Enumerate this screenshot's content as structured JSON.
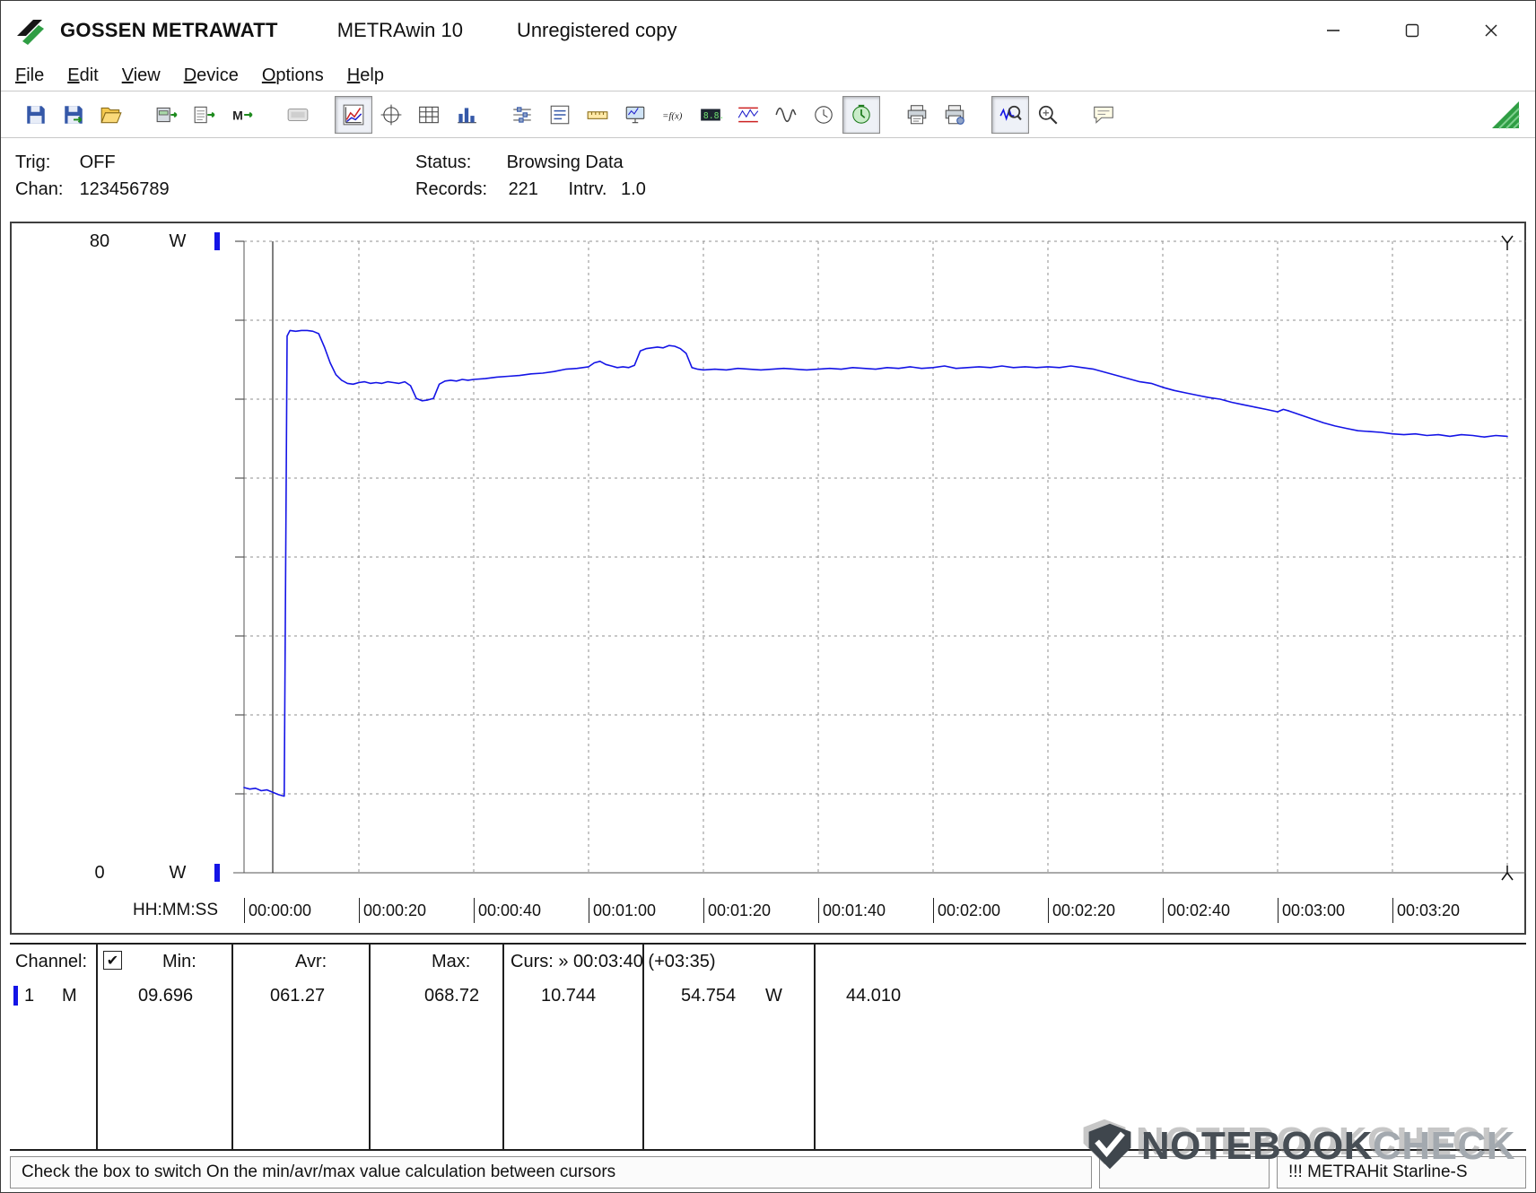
{
  "titlebar": {
    "brand": "GOSSEN METRAWATT",
    "app": "METRAwin 10",
    "license": "Unregistered copy"
  },
  "menu": {
    "items": [
      "File",
      "Edit",
      "View",
      "Device",
      "Options",
      "Help"
    ]
  },
  "toolbar": {
    "buttons": [
      "save-file",
      "save-selection",
      "open-file",
      "device-read",
      "memory-read",
      "memory-store",
      "lcd-display",
      "view-line-chart",
      "view-xy",
      "view-table",
      "view-histogram",
      "transfer-settings",
      "channel-list",
      "scale-settings",
      "monitor-online",
      "formula",
      "numeric-display",
      "limit-lines",
      "analog-wave",
      "interval-clock",
      "record-timer",
      "print",
      "print-form",
      "zoom-signal",
      "zoom-inspect",
      "annotation"
    ],
    "active_buttons": [
      "view-line-chart",
      "record-timer",
      "zoom-signal"
    ]
  },
  "infobar": {
    "trig_label": "Trig:",
    "trig_value": "OFF",
    "chan_label": "Chan:",
    "chan_value": "123456789",
    "status_label": "Status:",
    "status_value": "Browsing Data",
    "records_label": "Records:",
    "records_value": "221",
    "intrv_label": "Intrv.",
    "intrv_value": "1.0"
  },
  "chart_data": {
    "type": "line",
    "title": "",
    "y_axis": {
      "top_label": "80",
      "bottom_label": "0",
      "unit": "W",
      "ylim": [
        0,
        80
      ],
      "tick_step": 10
    },
    "x_axis": {
      "label": "HH:MM:SS",
      "tick_labels": [
        "00:00:00",
        "00:00:20",
        "00:00:40",
        "00:01:00",
        "00:01:20",
        "00:01:40",
        "00:02:00",
        "00:02:20",
        "00:02:40",
        "00:03:00",
        "00:03:20"
      ],
      "tick_step_s": 20,
      "xlim_s": [
        0,
        221
      ],
      "grid": "dashed"
    },
    "cursors": {
      "cursor1_s": 5,
      "cursor2_s": 220,
      "cursor2_label": "00:03:40",
      "delta_label": "+03:35"
    },
    "legend": "off",
    "series": [
      {
        "name": "channel-1-power-W",
        "color": "#1414e6",
        "points": [
          [
            0,
            10.8
          ],
          [
            1,
            10.6
          ],
          [
            2,
            10.7
          ],
          [
            3,
            10.4
          ],
          [
            4,
            10.5
          ],
          [
            5,
            10.2
          ],
          [
            6,
            9.9
          ],
          [
            7,
            9.7
          ],
          [
            7.5,
            68.0
          ],
          [
            8,
            68.7
          ],
          [
            9,
            68.6
          ],
          [
            10,
            68.7
          ],
          [
            11,
            68.7
          ],
          [
            12,
            68.6
          ],
          [
            13,
            68.3
          ],
          [
            14,
            66.6
          ],
          [
            15,
            64.6
          ],
          [
            16,
            63.1
          ],
          [
            17,
            62.4
          ],
          [
            18,
            62.0
          ],
          [
            19,
            61.9
          ],
          [
            20,
            62.1
          ],
          [
            21,
            62.2
          ],
          [
            22,
            62.0
          ],
          [
            23,
            62.1
          ],
          [
            24,
            62.0
          ],
          [
            25,
            62.2
          ],
          [
            26,
            62.1
          ],
          [
            27,
            62.0
          ],
          [
            28,
            62.2
          ],
          [
            29,
            61.7
          ],
          [
            30,
            60.1
          ],
          [
            31,
            59.8
          ],
          [
            32,
            59.9
          ],
          [
            33,
            60.1
          ],
          [
            34,
            61.9
          ],
          [
            35,
            62.3
          ],
          [
            36,
            62.4
          ],
          [
            37,
            62.3
          ],
          [
            38,
            62.5
          ],
          [
            39,
            62.4
          ],
          [
            40,
            62.5
          ],
          [
            42,
            62.6
          ],
          [
            44,
            62.8
          ],
          [
            46,
            62.9
          ],
          [
            48,
            63.0
          ],
          [
            50,
            63.2
          ],
          [
            52,
            63.3
          ],
          [
            54,
            63.5
          ],
          [
            56,
            63.8
          ],
          [
            58,
            63.9
          ],
          [
            60,
            64.1
          ],
          [
            61,
            64.6
          ],
          [
            62,
            64.8
          ],
          [
            63,
            64.4
          ],
          [
            64,
            64.2
          ],
          [
            65,
            64.0
          ],
          [
            66,
            64.1
          ],
          [
            67,
            64.0
          ],
          [
            68,
            64.3
          ],
          [
            69,
            66.1
          ],
          [
            70,
            66.4
          ],
          [
            71,
            66.5
          ],
          [
            72,
            66.6
          ],
          [
            73,
            66.5
          ],
          [
            74,
            66.8
          ],
          [
            75,
            66.7
          ],
          [
            76,
            66.4
          ],
          [
            77,
            65.8
          ],
          [
            78,
            64.0
          ],
          [
            79,
            63.8
          ],
          [
            80,
            63.7
          ],
          [
            82,
            63.8
          ],
          [
            84,
            63.7
          ],
          [
            86,
            63.9
          ],
          [
            88,
            63.8
          ],
          [
            90,
            63.7
          ],
          [
            92,
            63.8
          ],
          [
            94,
            63.9
          ],
          [
            96,
            63.8
          ],
          [
            98,
            63.7
          ],
          [
            100,
            63.8
          ],
          [
            102,
            63.9
          ],
          [
            104,
            63.8
          ],
          [
            106,
            64.0
          ],
          [
            108,
            63.9
          ],
          [
            110,
            63.8
          ],
          [
            112,
            64.0
          ],
          [
            114,
            63.9
          ],
          [
            116,
            64.1
          ],
          [
            118,
            63.9
          ],
          [
            120,
            64.0
          ],
          [
            122,
            64.2
          ],
          [
            124,
            63.9
          ],
          [
            126,
            64.0
          ],
          [
            128,
            64.1
          ],
          [
            130,
            64.0
          ],
          [
            132,
            64.2
          ],
          [
            134,
            64.0
          ],
          [
            136,
            64.1
          ],
          [
            138,
            64.0
          ],
          [
            140,
            64.1
          ],
          [
            142,
            64.0
          ],
          [
            144,
            64.2
          ],
          [
            146,
            64.0
          ],
          [
            148,
            63.8
          ],
          [
            150,
            63.4
          ],
          [
            152,
            63.0
          ],
          [
            154,
            62.6
          ],
          [
            156,
            62.2
          ],
          [
            158,
            62.0
          ],
          [
            160,
            61.5
          ],
          [
            162,
            61.1
          ],
          [
            164,
            60.8
          ],
          [
            166,
            60.5
          ],
          [
            168,
            60.2
          ],
          [
            170,
            60.0
          ],
          [
            172,
            59.6
          ],
          [
            174,
            59.3
          ],
          [
            176,
            59.0
          ],
          [
            178,
            58.7
          ],
          [
            180,
            58.4
          ],
          [
            181,
            58.7
          ],
          [
            182,
            58.5
          ],
          [
            184,
            58.0
          ],
          [
            186,
            57.5
          ],
          [
            188,
            57.0
          ],
          [
            190,
            56.6
          ],
          [
            192,
            56.3
          ],
          [
            194,
            56.0
          ],
          [
            196,
            55.9
          ],
          [
            198,
            55.8
          ],
          [
            200,
            55.6
          ],
          [
            202,
            55.5
          ],
          [
            204,
            55.6
          ],
          [
            206,
            55.4
          ],
          [
            208,
            55.5
          ],
          [
            210,
            55.3
          ],
          [
            212,
            55.5
          ],
          [
            214,
            55.4
          ],
          [
            216,
            55.2
          ],
          [
            218,
            55.4
          ],
          [
            220,
            55.3
          ]
        ]
      }
    ]
  },
  "table": {
    "header": {
      "channel": "Channel:",
      "checkbox_glyph": "✔",
      "min": "Min:",
      "avr": "Avr:",
      "max": "Max:",
      "curs": "Curs: » 00:03:40 (+03:35)"
    },
    "row": {
      "channel_num": "1",
      "mode": "M",
      "min": "09.696",
      "avr": "061.27",
      "max": "068.72",
      "cursor1": "10.744",
      "cursor2": "54.754",
      "unit": "W",
      "delta": "44.010"
    }
  },
  "statusbar": {
    "hint": "Check the box to switch On the min/avr/max value calculation between cursors",
    "device": "!!! METRAHit Starline-S"
  },
  "watermark": {
    "part1": "NOTEBOOK",
    "part2": "CHECK"
  }
}
